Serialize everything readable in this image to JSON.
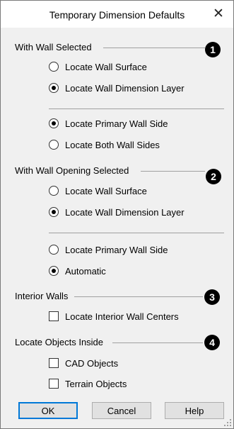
{
  "dialog": {
    "title": "Temporary Dimension Defaults"
  },
  "groups": {
    "wall": {
      "title": "With Wall Selected",
      "badge": "1",
      "locate_surface": "Locate Wall Surface",
      "locate_dimension_layer": "Locate Wall Dimension Layer",
      "locate_primary_side": "Locate Primary Wall Side",
      "locate_both_sides": "Locate Both Wall Sides"
    },
    "wall_opening": {
      "title": "With Wall Opening Selected",
      "badge": "2",
      "locate_surface": "Locate Wall Surface",
      "locate_dimension_layer": "Locate Wall Dimension Layer",
      "locate_primary_side": "Locate Primary Wall Side",
      "automatic": "Automatic"
    },
    "interior": {
      "title": "Interior Walls",
      "badge": "3",
      "locate_centers": "Locate Interior Wall Centers"
    },
    "objects": {
      "title": "Locate Objects Inside",
      "badge": "4",
      "cad": "CAD Objects",
      "terrain": "Terrain Objects"
    }
  },
  "state": {
    "wall_locate": "dimension_layer",
    "wall_side": "primary",
    "opening_locate": "dimension_layer",
    "opening_side": "automatic",
    "interior_centers": false,
    "cad_objects": false,
    "terrain_objects": false
  },
  "buttons": {
    "ok": "OK",
    "cancel": "Cancel",
    "help": "Help"
  }
}
